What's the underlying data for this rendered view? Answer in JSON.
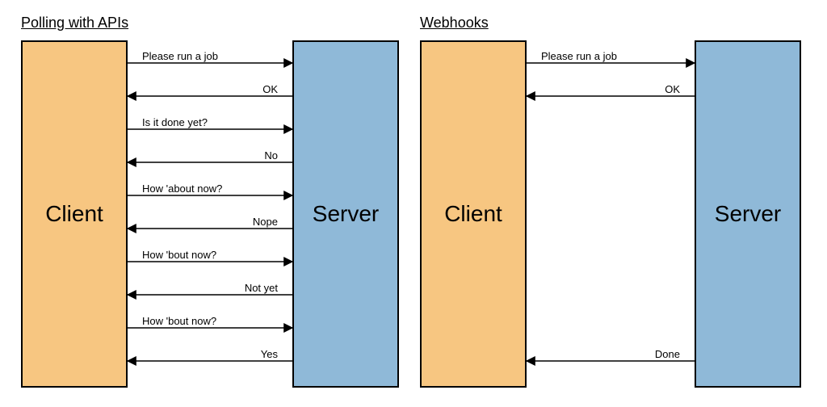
{
  "polling": {
    "title": "Polling with APIs",
    "client_label": "Client",
    "server_label": "Server",
    "messages": [
      {
        "text": "Please run a job",
        "dir": "right"
      },
      {
        "text": "OK",
        "dir": "left"
      },
      {
        "text": "Is it done yet?",
        "dir": "right"
      },
      {
        "text": "No",
        "dir": "left"
      },
      {
        "text": "How 'about now?",
        "dir": "right"
      },
      {
        "text": "Nope",
        "dir": "left"
      },
      {
        "text": "How 'bout now?",
        "dir": "right"
      },
      {
        "text": "Not yet",
        "dir": "left"
      },
      {
        "text": "How 'bout now?",
        "dir": "right"
      },
      {
        "text": "Yes",
        "dir": "left"
      }
    ]
  },
  "webhooks": {
    "title": "Webhooks",
    "client_label": "Client",
    "server_label": "Server",
    "messages": [
      {
        "text": "Please run a job",
        "dir": "right",
        "slot": 0
      },
      {
        "text": "OK",
        "dir": "left",
        "slot": 1
      },
      {
        "text": "Done",
        "dir": "left",
        "slot": 9
      }
    ]
  },
  "colors": {
    "client": "#f7c681",
    "server": "#8fb9d8"
  },
  "chart_data": [
    {
      "type": "table",
      "title": "Polling with APIs",
      "participants": [
        "Client",
        "Server"
      ],
      "exchanges": [
        {
          "from": "Client",
          "to": "Server",
          "label": "Please run a job"
        },
        {
          "from": "Server",
          "to": "Client",
          "label": "OK"
        },
        {
          "from": "Client",
          "to": "Server",
          "label": "Is it done yet?"
        },
        {
          "from": "Server",
          "to": "Client",
          "label": "No"
        },
        {
          "from": "Client",
          "to": "Server",
          "label": "How 'about now?"
        },
        {
          "from": "Server",
          "to": "Client",
          "label": "Nope"
        },
        {
          "from": "Client",
          "to": "Server",
          "label": "How 'bout now?"
        },
        {
          "from": "Server",
          "to": "Client",
          "label": "Not yet"
        },
        {
          "from": "Client",
          "to": "Server",
          "label": "How 'bout now?"
        },
        {
          "from": "Server",
          "to": "Client",
          "label": "Yes"
        }
      ]
    },
    {
      "type": "table",
      "title": "Webhooks",
      "participants": [
        "Client",
        "Server"
      ],
      "exchanges": [
        {
          "from": "Client",
          "to": "Server",
          "label": "Please run a job"
        },
        {
          "from": "Server",
          "to": "Client",
          "label": "OK"
        },
        {
          "from": "Server",
          "to": "Client",
          "label": "Done"
        }
      ]
    }
  ]
}
